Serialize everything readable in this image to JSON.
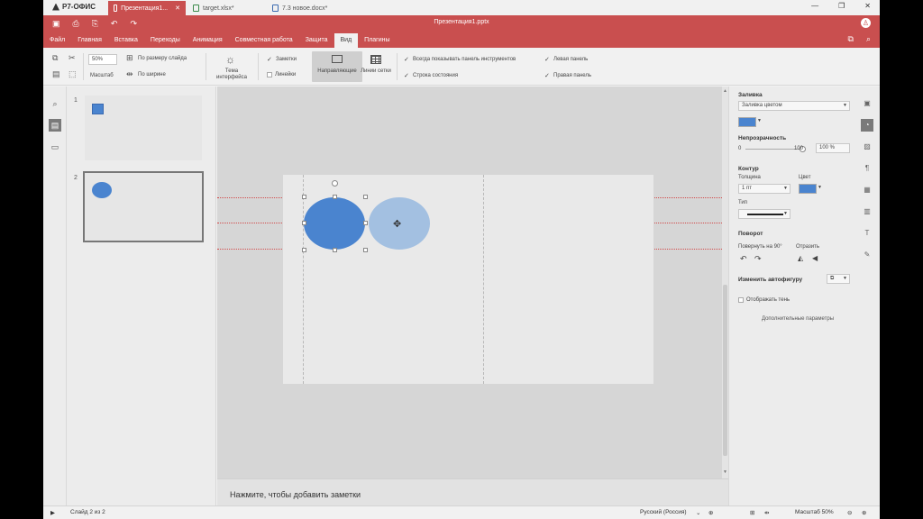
{
  "app": {
    "name": "Р7-ОФИС"
  },
  "tabs": [
    {
      "label": "Презентация1...",
      "active": true
    },
    {
      "label": "target.xlsx*",
      "active": false
    },
    {
      "label": "7.3 новое.docx*",
      "active": false
    }
  ],
  "window": {
    "title": "Презентация1.pptx"
  },
  "menu": [
    "Файл",
    "Главная",
    "Вставка",
    "Переходы",
    "Анимация",
    "Совместная работа",
    "Защита",
    "Вид",
    "Плагины"
  ],
  "toolbar": {
    "zoom_value": "50%",
    "zoom_label": "Масштаб",
    "fit_slide": "По размеру слайда",
    "fit_width": "По ширине",
    "theme_label": "Тема интерфейса",
    "notes": "Заметки",
    "rulers": "Линейки",
    "guides": "Направляющие",
    "gridlines": "Линии сетки",
    "always_show_toolbar": "Всегда показывать панель инструментов",
    "status_bar": "Строка состояния",
    "left_panel": "Левая панель",
    "right_panel": "Правая панель"
  },
  "slides": [
    {
      "num": "1",
      "shape": "square",
      "color": "#4a84cf"
    },
    {
      "num": "2",
      "shape": "ellipse",
      "color": "#4a84cf"
    }
  ],
  "canvas": {
    "shape_fill": "#4a84cf",
    "ghost_fill": "#9bbbe0",
    "guide_color": "#d24b4b"
  },
  "notes_placeholder": "Нажмите, чтобы добавить заметки",
  "right_panel": {
    "fill_header": "Заливка",
    "fill_type": "Заливка цветом",
    "fill_color": "#4a84cf",
    "opacity_header": "Непрозрачность",
    "opacity_min": "0",
    "opacity_max": "100",
    "opacity_value": "100 %",
    "stroke_header": "Контур",
    "thickness_label": "Толщина",
    "thickness_value": "1 пт",
    "color_label": "Цвет",
    "stroke_color": "#4a84cf",
    "type_label": "Тип",
    "rotation_header": "Поворот",
    "rotate_label": "Повернуть на 90°",
    "flip_label": "Отразить",
    "change_shape": "Изменить автофигуру",
    "show_shadow": "Отображать тень",
    "advanced": "Дополнительные параметры"
  },
  "status": {
    "slide_info": "Слайд 2 из 2",
    "language": "Русский (Россия)",
    "zoom": "Масштаб 50%"
  }
}
